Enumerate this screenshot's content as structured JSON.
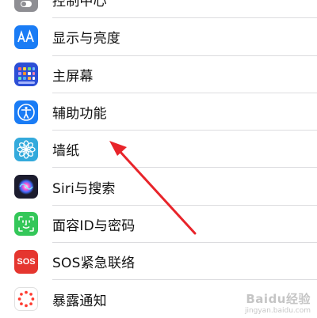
{
  "settings": {
    "items": [
      {
        "label": "控制中心",
        "icon": "toggle-switches-icon",
        "color": "#8e8e93"
      },
      {
        "label": "显示与亮度",
        "icon": "text-size-aa-icon",
        "color": "#1a7cf5"
      },
      {
        "label": "主屏幕",
        "icon": "app-grid-icon",
        "color": "#2c4fd6"
      },
      {
        "label": "辅助功能",
        "icon": "accessibility-person-icon",
        "color": "#1a7cf5"
      },
      {
        "label": "墙纸",
        "icon": "flower-icon",
        "color": "#34aadc"
      },
      {
        "label": "Siri与搜索",
        "icon": "siri-orb-icon",
        "color": "#1c1c2e"
      },
      {
        "label": "面容ID与密码",
        "icon": "face-id-icon",
        "color": "#34c759"
      },
      {
        "label": "SOS紧急联络",
        "icon": "sos-icon",
        "color": "#e5362f",
        "icon_text": "SOS"
      },
      {
        "label": "暴露通知",
        "icon": "exposure-notification-icon",
        "color": "#ff3b30"
      }
    ]
  },
  "annotation": {
    "arrow_color": "#e8242a",
    "points_to": "辅助功能"
  },
  "watermark": {
    "main": "Baidu经验",
    "sub": "jingyan.baidu.com"
  }
}
